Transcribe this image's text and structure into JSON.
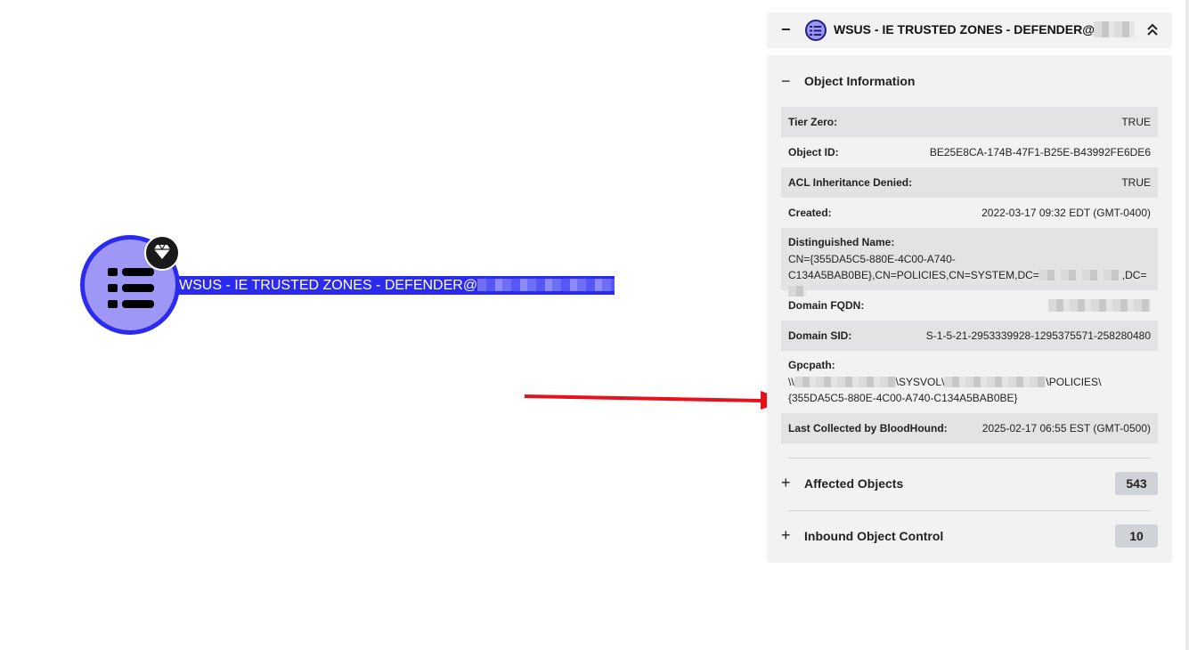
{
  "graph_node": {
    "label": "WSUS - IE TRUSTED ZONES - DEFENDER@",
    "node_icon": "list-icon",
    "badge_icon": "gem-icon",
    "node_color": "#2b2bf0",
    "node_fill": "#9e97f5"
  },
  "annotation": {
    "arrow_color": "#e8101a"
  },
  "panel_header": {
    "collapse_symbol": "−",
    "title": "WSUS - IE TRUSTED ZONES - DEFENDER@"
  },
  "object_information": {
    "toggle_symbol": "−",
    "title": "Object Information",
    "rows": [
      {
        "key": "Tier Zero:",
        "value": "TRUE"
      },
      {
        "key": "Object ID:",
        "value": "BE25E8CA-174B-47F1-B25E-B43992FE6DE6"
      },
      {
        "key": "ACL Inheritance Denied:",
        "value": "TRUE"
      },
      {
        "key": "Created:",
        "value": "2022-03-17 09:32 EDT (GMT-0400)"
      }
    ],
    "distinguished_name": {
      "key": "Distinguished Name:",
      "line1": "CN={355DA5C5-880E-4C00-A740-",
      "line2_a": "C134A5BAB0BE},CN=POLICIES,CN=SYSTEM,DC=",
      "line2_b": ",DC="
    },
    "domain_fqdn": {
      "key": "Domain FQDN:"
    },
    "domain_sid": {
      "key": "Domain SID:",
      "value": "S-1-5-21-2953339928-1295375571-258280480"
    },
    "gpcpath": {
      "key": "Gpcpath:",
      "line1_a": "\\\\",
      "line1_b": "\\SYSVOL\\",
      "line1_c": "\\POLICIES\\",
      "line2": "{355DA5C5-880E-4C00-A740-C134A5BAB0BE}"
    },
    "last_collected": {
      "key": "Last Collected by BloodHound:",
      "value": "2025-02-17 06:55 EST (GMT-0500)"
    }
  },
  "affected_objects": {
    "toggle_symbol": "+",
    "title": "Affected Objects",
    "count": "543"
  },
  "inbound_control": {
    "toggle_symbol": "+",
    "title": "Inbound Object Control",
    "count": "10"
  }
}
